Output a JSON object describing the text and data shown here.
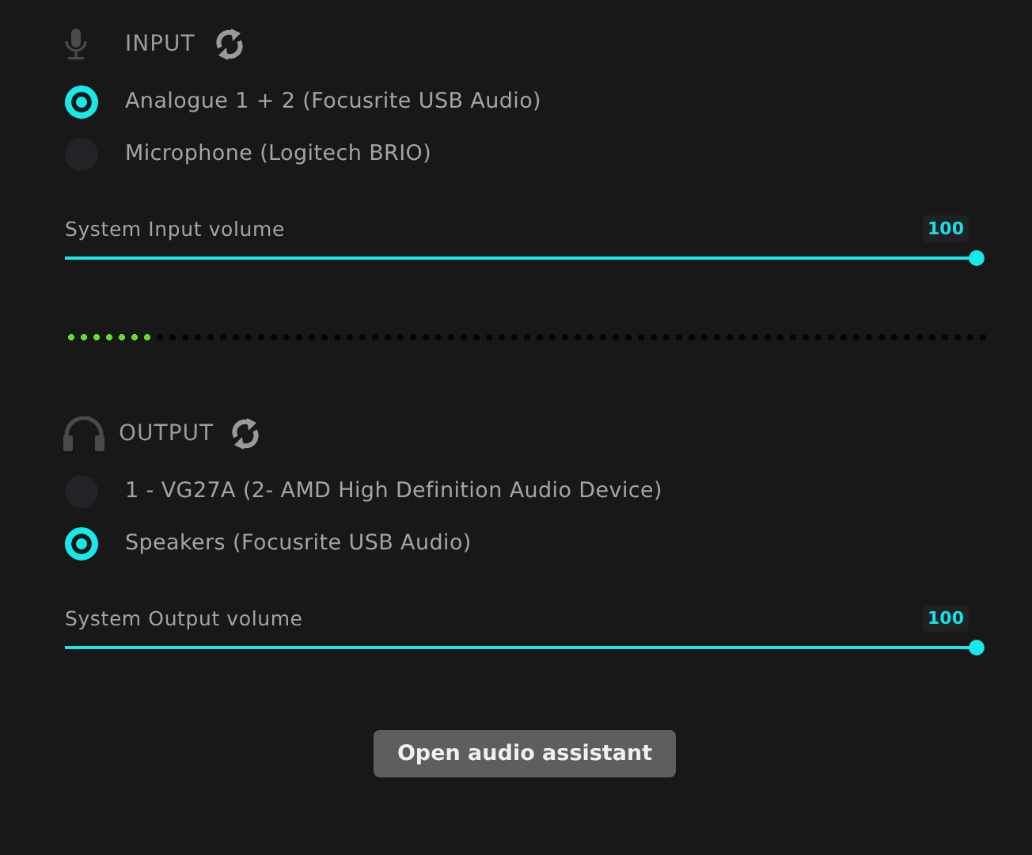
{
  "input": {
    "title": "INPUT",
    "devices": [
      {
        "label": "Analogue 1 + 2 (Focusrite USB Audio)",
        "selected": true
      },
      {
        "label": "Microphone (Logitech BRIO)",
        "selected": false
      }
    ],
    "volume": {
      "label": "System Input volume",
      "reading": "100",
      "level": 1
    },
    "meter": {
      "level": 0.1
    }
  },
  "output": {
    "title": "OUTPUT",
    "devices": [
      {
        "label": "1 - VG27A (2- AMD High Definition Audio Device)",
        "selected": false
      },
      {
        "label": "Speakers (Focusrite USB Audio)",
        "selected": true
      }
    ],
    "volume": {
      "label": "System Output volume",
      "reading": "100",
      "level": 1
    }
  },
  "button": "Open audio assistant"
}
